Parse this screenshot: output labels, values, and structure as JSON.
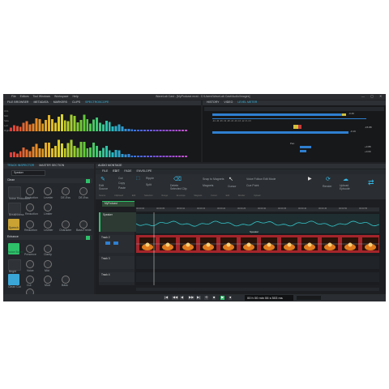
{
  "window": {
    "title": "WaveLab Cast - [MyPodcast.mcst - C:\\Users\\WaveLab Cast\\Audio\\Images]",
    "menu": [
      "File",
      "Editors",
      "Tool Windows",
      "Workspace",
      "Help"
    ]
  },
  "top_left": {
    "tabs": [
      {
        "label": "FILE BROWSER",
        "active": false
      },
      {
        "label": "METADATA",
        "active": false
      },
      {
        "label": "MARKERS",
        "active": false
      },
      {
        "label": "CLIPS",
        "active": false
      },
      {
        "label": "SPECTROSCOPE",
        "active": true
      }
    ],
    "side_labels": [
      "Ch1",
      "Mid",
      "Side",
      "Left",
      "Right"
    ]
  },
  "top_right": {
    "tabs": [
      {
        "label": "HISTORY",
        "active": false
      },
      {
        "label": "VIDEO",
        "active": false
      },
      {
        "label": "LEVEL METER",
        "active": true
      }
    ],
    "meter_value_1": "-0.49",
    "meter_value_2": "-15.88",
    "meter_value_3": "-0.19",
    "meter_value_4": "+3.88",
    "meter_value_5": "+0.00",
    "pan_label": "Pan"
  },
  "inspector": {
    "tabs": [
      {
        "label": "TRACK INSPECTOR",
        "active": true
      },
      {
        "label": "MASTER SECTION",
        "active": false
      }
    ],
    "track": "Speaker",
    "clean": {
      "title": "Clean",
      "items": [
        "Noise Reduction",
        "Reduction",
        "Leveler",
        "DE-Ess",
        "DE-Ess",
        "Breathiness",
        "Reduction",
        "Limiter"
      ]
    },
    "row2_labels": [
      "Speech",
      "Reduction",
      "Leveler",
      "Character",
      "Bass/Treble"
    ],
    "enhance": {
      "title": "Enhance",
      "items": [
        "Voice Boost",
        "Presence",
        "Clarity",
        "Bright",
        "Voice",
        "Mid",
        "Clean Cut",
        "Cut",
        "Mud",
        "Bass",
        "Optimize"
      ]
    }
  },
  "montage": {
    "tab_label": "AUDIO MONTAGE",
    "ribbon_tabs": [
      {
        "label": "FILE",
        "active": false
      },
      {
        "label": "EDIT",
        "active": true
      },
      {
        "label": "FADE",
        "active": false
      },
      {
        "label": "ENVELOPE",
        "active": false
      }
    ],
    "tools": {
      "edit_source": "Edit Source",
      "cut": "Cut",
      "copy": "Copy",
      "paste": "Paste",
      "ripple": "Ripple",
      "split": "Split",
      "delete": "Delete Selected Clip",
      "snap": "Snap to Magnets",
      "magnets": "Magnets",
      "cursor": "Cursor",
      "voice_follow": "Voice Follow Edit Mode",
      "cue_point": "Cue Point",
      "render": "Render",
      "upload": "Upload Episode"
    },
    "ribbon_groups": [
      "Source",
      "Clipboard",
      "Edit",
      "Selection Range",
      "Envelope",
      "Magnets",
      "Cursor",
      "Edit",
      "Render",
      "Upload"
    ],
    "file_tab": "MyPodcast",
    "tracks": [
      {
        "name": "Speaker",
        "clip": "Speaker"
      },
      {
        "name": "Track 2"
      },
      {
        "name": "Track 3"
      },
      {
        "name": "Track 4"
      }
    ],
    "ruler": [
      "00:00:00",
      "00:00:05",
      "00:00:10",
      "00:00:15",
      "00:00:20",
      "00:00:25",
      "00:00:30",
      "00:00:35",
      "00:00:40",
      "00:00:45",
      "00:00:50",
      "00:00:55"
    ]
  },
  "transport": {
    "time": "00 h 00 min 06 s 503 ms",
    "buttons": [
      "to-start",
      "prev",
      "rewind",
      "forward",
      "next",
      "loop",
      "stop",
      "play",
      "record"
    ]
  },
  "colors": {
    "accent": "#35b8e6",
    "green": "#2ec16a",
    "meter_blue": "#2f7fd0",
    "clip_red": "#a4252b",
    "waveform": "#34c4c9"
  }
}
